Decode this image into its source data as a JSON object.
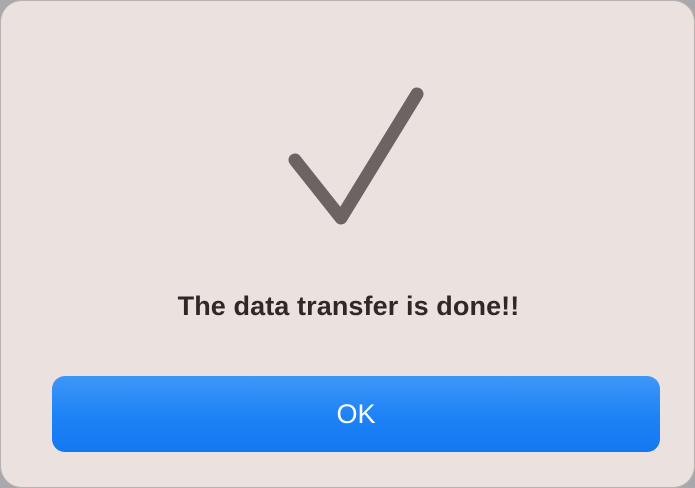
{
  "dialog": {
    "icon": "checkmark-icon",
    "icon_color": "#6b6462",
    "message": "The data transfer is done!!",
    "ok_label": "OK",
    "accent_color": "#1d82f6",
    "background_color": "#ebe2df"
  }
}
